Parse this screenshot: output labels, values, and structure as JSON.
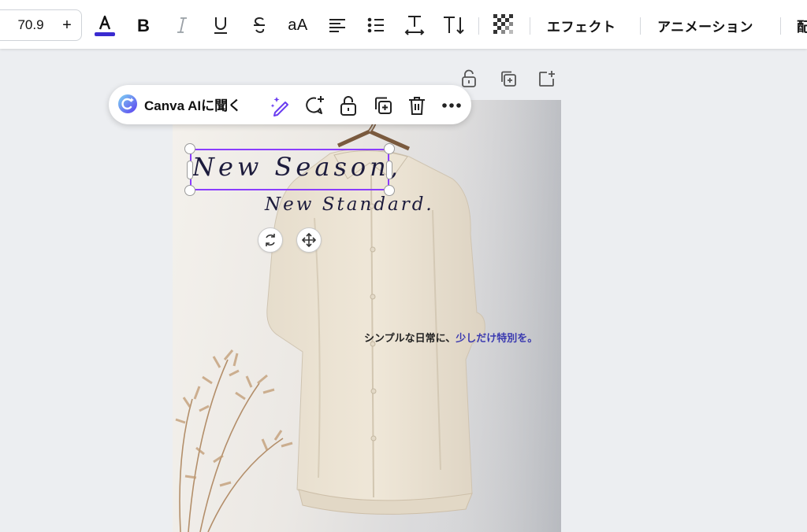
{
  "toolbar": {
    "font_size": {
      "value": "70.9",
      "minus_label": "-",
      "plus_label": "+"
    },
    "text_color": "#3a2bd0",
    "case_label": "aA",
    "effects_label": "エフェクト",
    "animation_label": "アニメーション",
    "position_label": "配"
  },
  "context_menu": {
    "ai_label": "Canva AIに聞く"
  },
  "canvas": {
    "headline": "New Season,",
    "subline": "New Standard.",
    "tagline_part1": "シンプルな日常に、",
    "tagline_part2": "少しだけ特別を。"
  },
  "colors": {
    "accent": "#8b3dff",
    "tagline_highlight": "#3b3ab0"
  }
}
